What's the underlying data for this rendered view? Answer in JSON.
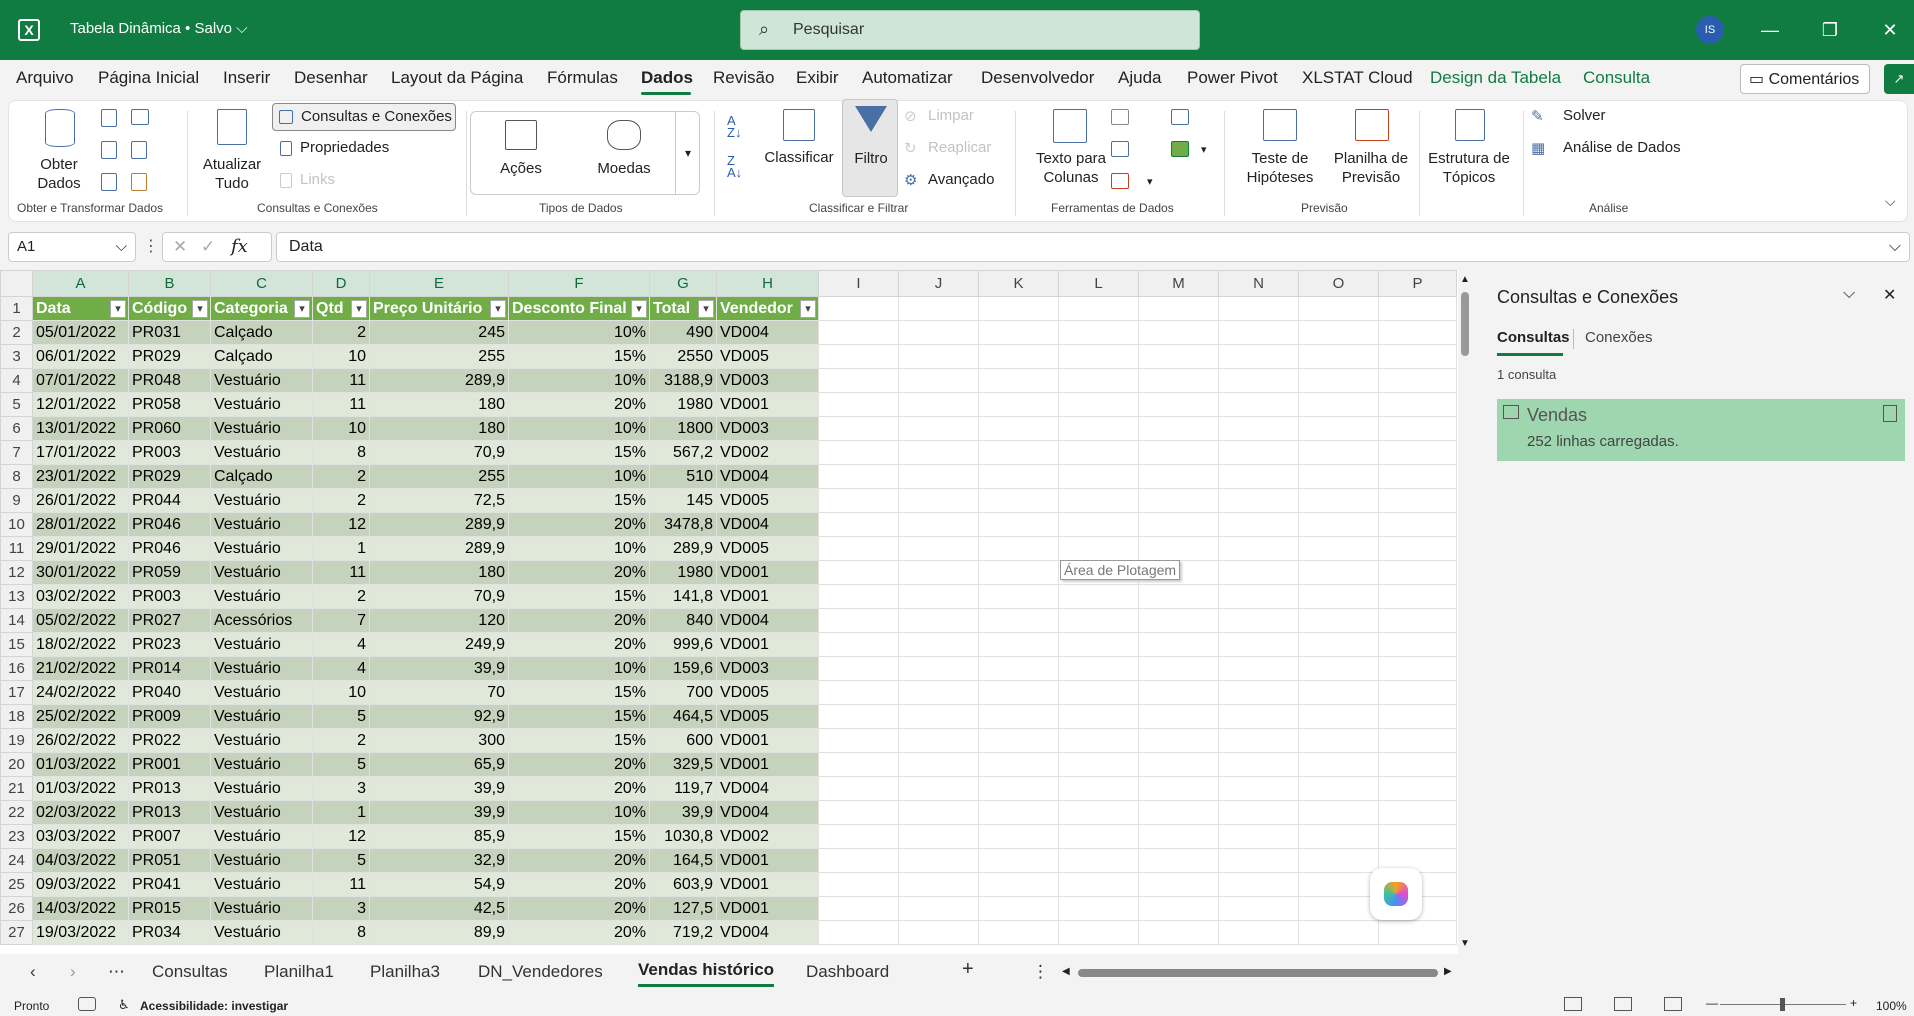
{
  "titlebar": {
    "doc_title": "Tabela Dinâmica • Salvo",
    "search_placeholder": "Pesquisar",
    "avatar_initials": "IS"
  },
  "menu": {
    "items": [
      "Arquivo",
      "Página Inicial",
      "Inserir",
      "Desenhar",
      "Layout da Página",
      "Fórmulas",
      "Dados",
      "Revisão",
      "Exibir",
      "Automatizar",
      "Desenvolvedor",
      "Ajuda",
      "Power Pivot",
      "XLSTAT Cloud",
      "Design da Tabela",
      "Consulta"
    ],
    "comments_label": "Comentários"
  },
  "ribbon": {
    "get_data": "Obter\nDados",
    "refresh_all": "Atualizar\nTudo",
    "queries_connections": "Consultas e Conexões",
    "properties": "Propriedades",
    "links": "Links",
    "stocks": "Ações",
    "currencies": "Moedas",
    "sort": "Classificar",
    "filter": "Filtro",
    "clear": "Limpar",
    "reapply": "Reaplicar",
    "advanced": "Avançado",
    "text_to_columns": "Texto para\nColunas",
    "what_if": "Teste de\nHipóteses",
    "forecast_sheet": "Planilha de\nPrevisão",
    "outline": "Estrutura de\nTópicos",
    "solver": "Solver",
    "data_analysis": "Análise de Dados",
    "groups": {
      "g1": "Obter e Transformar Dados",
      "g2": "Consultas e Conexões",
      "g3": "Tipos de Dados",
      "g4": "Classificar e Filtrar",
      "g5": "Ferramentas de Dados",
      "g6": "Previsão",
      "g7": "Análise"
    }
  },
  "formula": {
    "name_box": "A1",
    "fx": "fx",
    "content": "Data"
  },
  "grid": {
    "columns": [
      "A",
      "B",
      "C",
      "D",
      "E",
      "F",
      "G",
      "H",
      "I",
      "J",
      "K",
      "L",
      "M",
      "N",
      "O",
      "P"
    ],
    "headers": [
      "Data",
      "Código",
      "Categoria",
      "Qtd",
      "Preço Unitário",
      "Desconto Final",
      "Total",
      "Vendedor"
    ],
    "rows": [
      [
        "05/01/2022",
        "PR031",
        "Calçado",
        "2",
        "245",
        "10%",
        "490",
        "VD004"
      ],
      [
        "06/01/2022",
        "PR029",
        "Calçado",
        "10",
        "255",
        "15%",
        "2550",
        "VD005"
      ],
      [
        "07/01/2022",
        "PR048",
        "Vestuário",
        "11",
        "289,9",
        "10%",
        "3188,9",
        "VD003"
      ],
      [
        "12/01/2022",
        "PR058",
        "Vestuário",
        "11",
        "180",
        "20%",
        "1980",
        "VD001"
      ],
      [
        "13/01/2022",
        "PR060",
        "Vestuário",
        "10",
        "180",
        "10%",
        "1800",
        "VD003"
      ],
      [
        "17/01/2022",
        "PR003",
        "Vestuário",
        "8",
        "70,9",
        "15%",
        "567,2",
        "VD002"
      ],
      [
        "23/01/2022",
        "PR029",
        "Calçado",
        "2",
        "255",
        "10%",
        "510",
        "VD004"
      ],
      [
        "26/01/2022",
        "PR044",
        "Vestuário",
        "2",
        "72,5",
        "15%",
        "145",
        "VD005"
      ],
      [
        "28/01/2022",
        "PR046",
        "Vestuário",
        "12",
        "289,9",
        "20%",
        "3478,8",
        "VD004"
      ],
      [
        "29/01/2022",
        "PR046",
        "Vestuário",
        "1",
        "289,9",
        "10%",
        "289,9",
        "VD005"
      ],
      [
        "30/01/2022",
        "PR059",
        "Vestuário",
        "11",
        "180",
        "20%",
        "1980",
        "VD001"
      ],
      [
        "03/02/2022",
        "PR003",
        "Vestuário",
        "2",
        "70,9",
        "15%",
        "141,8",
        "VD001"
      ],
      [
        "05/02/2022",
        "PR027",
        "Acessórios",
        "7",
        "120",
        "20%",
        "840",
        "VD004"
      ],
      [
        "18/02/2022",
        "PR023",
        "Vestuário",
        "4",
        "249,9",
        "20%",
        "999,6",
        "VD001"
      ],
      [
        "21/02/2022",
        "PR014",
        "Vestuário",
        "4",
        "39,9",
        "10%",
        "159,6",
        "VD003"
      ],
      [
        "24/02/2022",
        "PR040",
        "Vestuário",
        "10",
        "70",
        "15%",
        "700",
        "VD005"
      ],
      [
        "25/02/2022",
        "PR009",
        "Vestuário",
        "5",
        "92,9",
        "15%",
        "464,5",
        "VD005"
      ],
      [
        "26/02/2022",
        "PR022",
        "Vestuário",
        "2",
        "300",
        "15%",
        "600",
        "VD001"
      ],
      [
        "01/03/2022",
        "PR001",
        "Vestuário",
        "5",
        "65,9",
        "20%",
        "329,5",
        "VD001"
      ],
      [
        "01/03/2022",
        "PR013",
        "Vestuário",
        "3",
        "39,9",
        "20%",
        "119,7",
        "VD004"
      ],
      [
        "02/03/2022",
        "PR013",
        "Vestuário",
        "1",
        "39,9",
        "10%",
        "39,9",
        "VD004"
      ],
      [
        "03/03/2022",
        "PR007",
        "Vestuário",
        "12",
        "85,9",
        "15%",
        "1030,8",
        "VD002"
      ],
      [
        "04/03/2022",
        "PR051",
        "Vestuário",
        "5",
        "32,9",
        "20%",
        "164,5",
        "VD001"
      ],
      [
        "09/03/2022",
        "PR041",
        "Vestuário",
        "11",
        "54,9",
        "20%",
        "603,9",
        "VD001"
      ],
      [
        "14/03/2022",
        "PR015",
        "Vestuário",
        "3",
        "42,5",
        "20%",
        "127,5",
        "VD001"
      ],
      [
        "19/03/2022",
        "PR034",
        "Vestuário",
        "8",
        "89,9",
        "20%",
        "719,2",
        "VD004"
      ]
    ],
    "plot_area_tooltip": "Área de Plotagem"
  },
  "panel": {
    "title": "Consultas e Conexões",
    "tab_queries": "Consultas",
    "tab_connections": "Conexões",
    "count": "1 consulta",
    "query_name": "Vendas",
    "query_status": "252 linhas carregadas."
  },
  "sheets": {
    "tabs": [
      "Consultas",
      "Planilha1",
      "Planilha3",
      "DN_Vendedores",
      "Vendas histórico",
      "Dashboard"
    ],
    "active": "Vendas histórico"
  },
  "status": {
    "ready": "Pronto",
    "accessibility": "Acessibilidade: investigar",
    "zoom": "100%"
  },
  "colors": {
    "brand": "#107c41",
    "table_header": "#70ad47",
    "band_a": "#c5d3bd",
    "band_b": "#dfe8d9",
    "query_card": "#9ed6b0"
  }
}
